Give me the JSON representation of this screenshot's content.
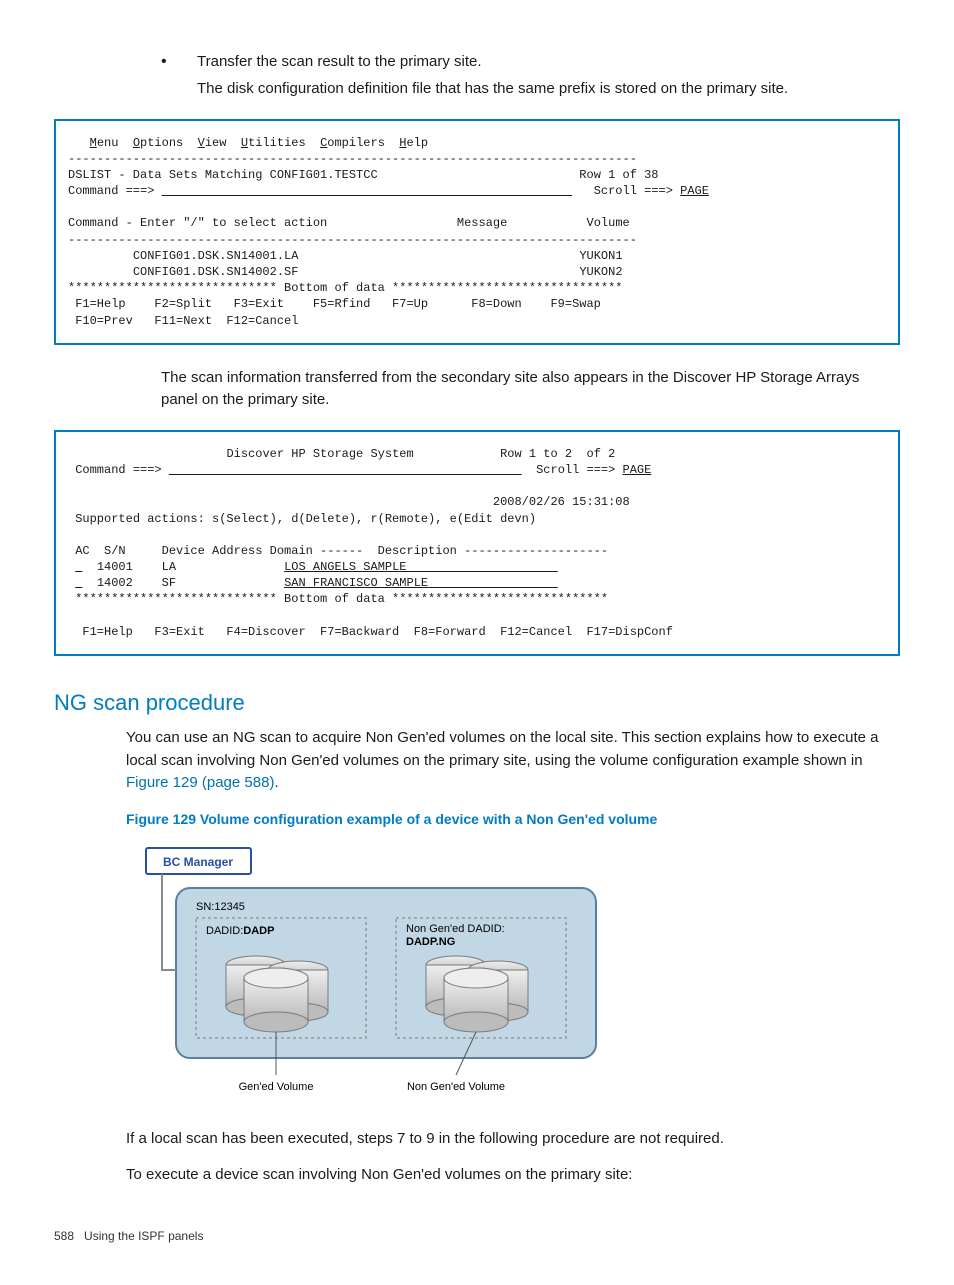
{
  "bullet": {
    "text": "Transfer the scan result to the primary site.",
    "sub": "The disk configuration definition file that has the same prefix is stored on the primary site."
  },
  "term1": {
    "menu": [
      "Menu",
      "Options",
      "View",
      "Utilities",
      "Compilers",
      "Help"
    ],
    "sep": "-------------------------------------------------------------------------------",
    "title": "DSLIST - Data Sets Matching CONFIG01.TESTCC",
    "row_info": "Row 1 of 38",
    "cmd_label": "Command ===>",
    "scroll": "Scroll ===> PAGE",
    "instr": "Command - Enter \"/\" to select action",
    "col_msg": "Message",
    "col_vol": "Volume",
    "ds1": "CONFIG01.DSK.SN14001.LA",
    "vol1": "YUKON1",
    "ds2": "CONFIG01.DSK.SN14002.SF",
    "vol2": "YUKON2",
    "bottom": "***************************** Bottom of data ********************************",
    "fkeys": " F1=Help    F2=Split   F3=Exit    F5=Rfind   F7=Up      F8=Down    F9=Swap\n F10=Prev   F11=Next  F12=Cancel"
  },
  "mid_para": "The scan information transferred from the secondary site also appears in the Discover HP Storage Arrays panel on the primary site.",
  "term2": {
    "title": "Discover HP Storage System",
    "row_info": "Row 1 to 2  of 2",
    "cmd_label": "Command ===>",
    "scroll": "Scroll ===> PAGE",
    "timestamp": "2008/02/26 15:31:08",
    "supported": "Supported actions: s(Select), d(Delete), r(Remote), e(Edit devn)",
    "header": " AC  S/N     Device Address Domain ------  Description --------------------",
    "r1_sn": "14001",
    "r1_ad": "LA",
    "r1_desc": "LOS ANGELS SAMPLE",
    "r2_sn": "14002",
    "r2_ad": "SF",
    "r2_desc": "SAN FRANCISCO SAMPLE",
    "bottom": " **************************** Bottom of data ******************************",
    "fkeys": "  F1=Help   F3=Exit   F4=Discover  F7=Backward  F8=Forward  F12=Cancel  F17=DispConf"
  },
  "ng": {
    "heading": "NG scan procedure",
    "para": "You can use an NG scan to acquire Non Gen'ed volumes on the local site. This section explains how to execute a local scan involving Non Gen'ed volumes on the primary site, using the volume configuration example shown in ",
    "link": "Figure 129 (page 588)",
    "period": ".",
    "fig_caption": "Figure 129 Volume configuration example of a device with a Non Gen'ed volume",
    "bc_label": "BC Manager",
    "sn_label": "SN:12345",
    "dadid_label": "DADID:",
    "dadid_val": "DADP",
    "ng_label1": "Non Gen'ed DADID:",
    "ng_label2": "DADP.NG",
    "gen_vol": "Gen'ed Volume",
    "nongen_vol": "Non Gen'ed Volume",
    "para2": "If a local scan has been executed, steps 7 to 9 in the following procedure are not required.",
    "para3": "To execute a device scan involving Non Gen'ed volumes on the primary site:"
  },
  "footer": {
    "page": "588",
    "title": "Using the ISPF panels"
  }
}
